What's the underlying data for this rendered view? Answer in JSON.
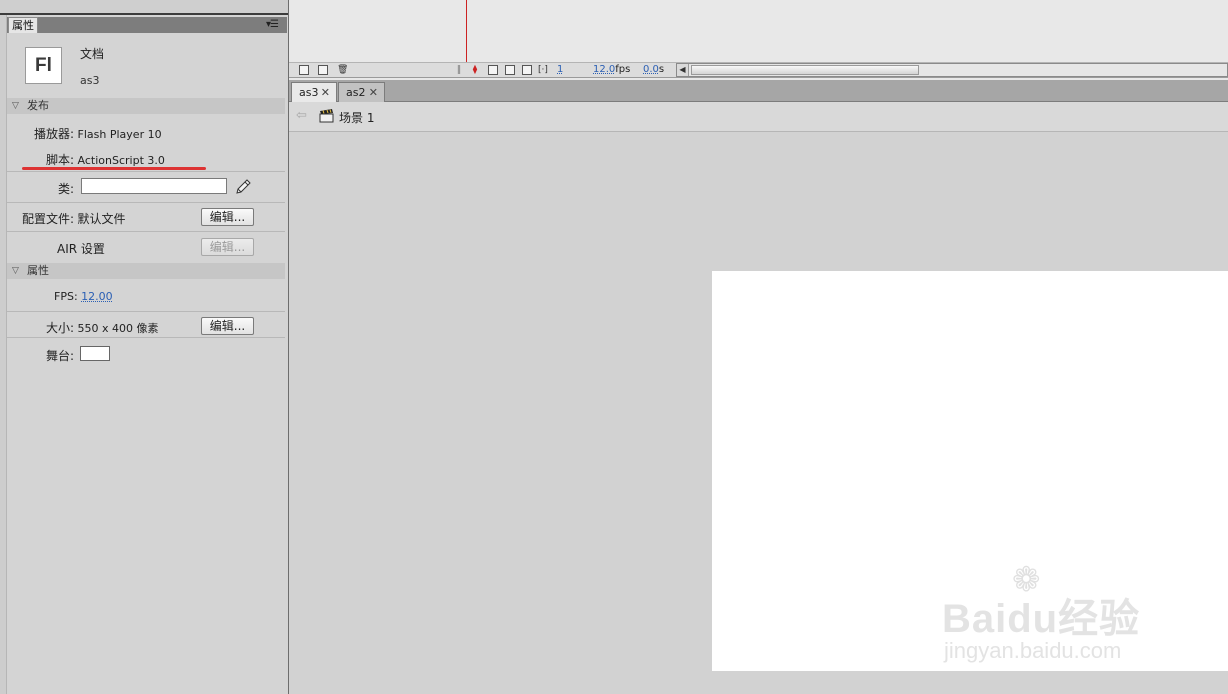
{
  "properties_panel": {
    "tab_label": "属性",
    "menu_glyph": "▾☰",
    "doc_logo_text": "Fl",
    "doc_type": "文档",
    "doc_name": "as3",
    "publish_section": {
      "title": "发布",
      "player_label": "播放器:",
      "player_value": "Flash Player 10",
      "script_label": "脚本:",
      "script_value": "ActionScript 3.0",
      "class_label": "类:",
      "class_value": "",
      "profile_label": "配置文件:",
      "profile_value": "默认文件",
      "profile_edit": "编辑...",
      "air_label": "AIR 设置",
      "air_edit": "编辑..."
    },
    "properties_section": {
      "title": "属性",
      "fps_label": "FPS:",
      "fps_value": "12.00",
      "size_label": "大小:",
      "size_value": "550 x 400 像素",
      "size_edit": "编辑...",
      "stage_label": "舞台:",
      "stage_color": "#ffffff"
    }
  },
  "timeline": {
    "frame_number": "1",
    "fps_value": "12.0",
    "fps_unit": "fps",
    "time_value": "0.0",
    "time_unit": "s",
    "playhead_color": "#cc2222"
  },
  "doc_tabs": [
    {
      "label": "as3",
      "close": "✕",
      "active": true
    },
    {
      "label": "as2",
      "close": "✕",
      "active": false
    }
  ],
  "edit_bar": {
    "scene_label": "场景 1"
  },
  "watermark": {
    "brand": "Baidu经验",
    "site": "jingyan.baidu.com"
  },
  "colors": {
    "annotation_underline": "#dd3333",
    "link": "#2b5fb4"
  }
}
